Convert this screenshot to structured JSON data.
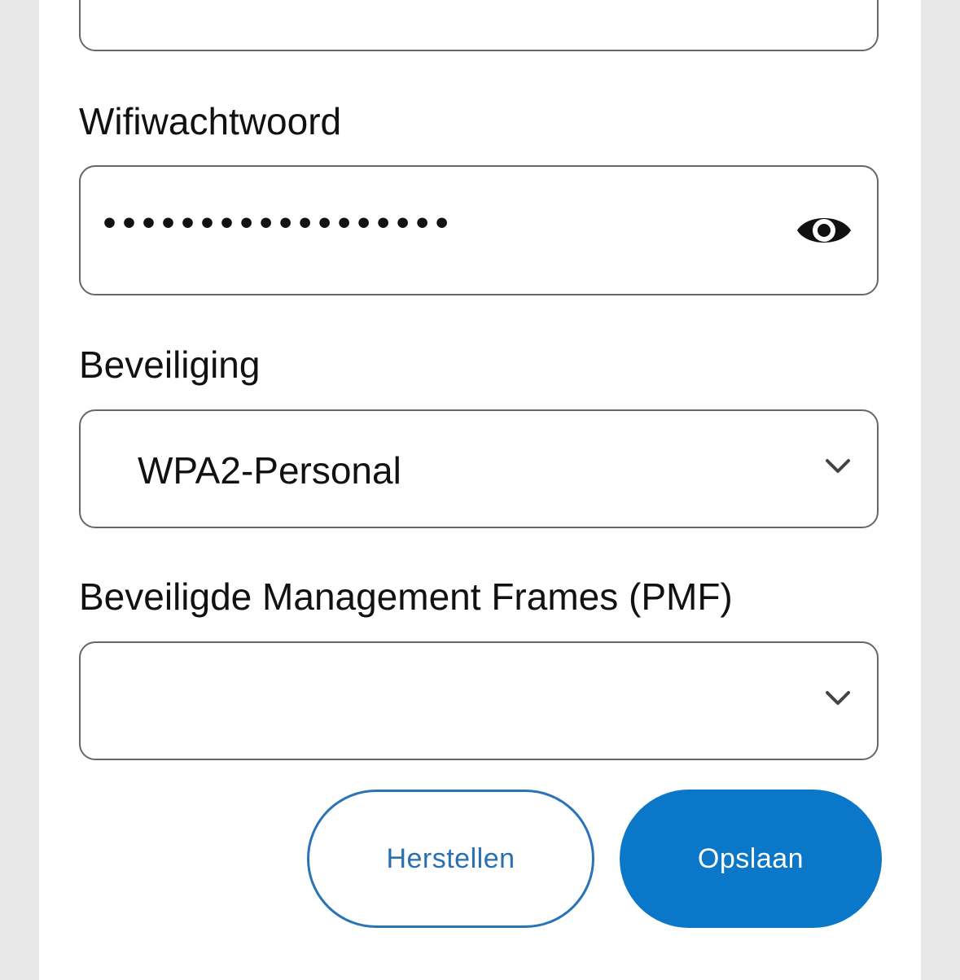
{
  "form": {
    "password": {
      "label": "Wifiwachtwoord",
      "value": "••••••••••••••••••",
      "toggle_icon": "eye-icon"
    },
    "security": {
      "label": "Beveiliging",
      "selected": "WPA2-Personal",
      "icon": "chevron-down-icon"
    },
    "pmf": {
      "label": "Beveiligde Management Frames (PMF)",
      "selected": "",
      "icon": "chevron-down-icon"
    }
  },
  "actions": {
    "reset_label": "Herstellen",
    "save_label": "Opslaan"
  },
  "colors": {
    "primary": "#0b77c8",
    "secondary_border": "#2a73b7",
    "field_border": "#666666",
    "background": "#e8e8e8"
  }
}
